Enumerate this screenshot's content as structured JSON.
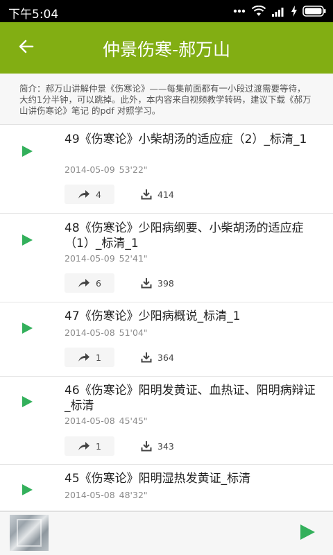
{
  "status": {
    "time": "下午5:04"
  },
  "header": {
    "title": "仲景伤寒-郝万山"
  },
  "intro": {
    "text": "简介：郝万山讲解仲景《伤寒论》——每集前面都有一小段过渡需要等待，大约1分半钟，可以跳掉。此外，本内容来自视频教学转码，建议下载《郝万山讲伤寒论》笔记 的pdf 对照学习。"
  },
  "colors": {
    "brand": "#82ae13",
    "play": "#33b05b"
  },
  "episodes": [
    {
      "title": "49《伤寒论》小柴胡汤的适应症（2）_标清_1",
      "date": "2014-05-09",
      "duration": "53'22\"",
      "shares": "4",
      "downloads": "414"
    },
    {
      "title": "48《伤寒论》少阳病纲要、小柴胡汤的适应症（1）_标清_1",
      "date": "2014-05-09",
      "duration": "52'41\"",
      "shares": "6",
      "downloads": "398"
    },
    {
      "title": "47《伤寒论》少阳病概说_标清_1",
      "date": "2014-05-08",
      "duration": "51'04\"",
      "shares": "1",
      "downloads": "364"
    },
    {
      "title": "46《伤寒论》阳明发黄证、血热证、阳明病辩证_标清",
      "date": "2014-05-08",
      "duration": "45'45\"",
      "shares": "1",
      "downloads": "343"
    },
    {
      "title": "45《伤寒论》阳明湿热发黄证_标清",
      "date": "2014-05-08",
      "duration": "48'32\""
    }
  ]
}
